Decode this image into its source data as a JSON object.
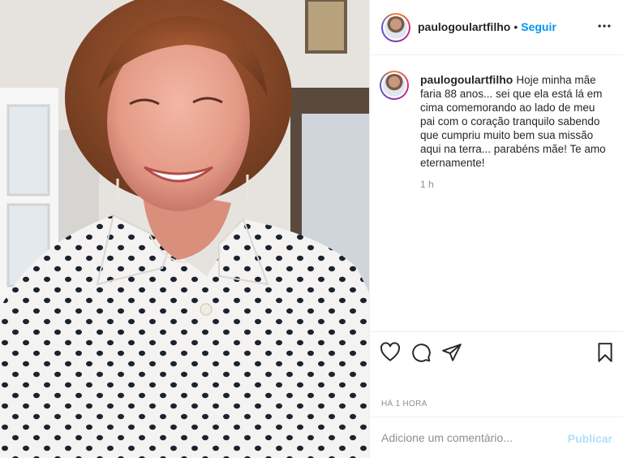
{
  "post": {
    "username": "paulogoulartfilho",
    "follow_label": "Seguir",
    "separator": "•",
    "caption": "Hoje minha mãe faria 88 anos... sei que ela está lá em cima comemorando ao lado de meu pai com o coração tranquilo sabendo que cumpriu muito bem sua missão aqui na terra... parabéns mãe! Te amo eternamente!",
    "caption_age": "1 h",
    "posted_ago": "HÁ 1 HORA",
    "comment_placeholder": "Adicione um comentário...",
    "publish_label": "Publicar"
  },
  "icons": {
    "more": "more-options-icon",
    "like": "heart-icon",
    "comment": "comment-icon",
    "share": "share-icon",
    "save": "bookmark-icon"
  },
  "colors": {
    "accent": "#0095f6",
    "publish_disabled": "#b2dffc",
    "muted": "#8e8e8e",
    "text": "#262626",
    "divider": "#efefef"
  }
}
